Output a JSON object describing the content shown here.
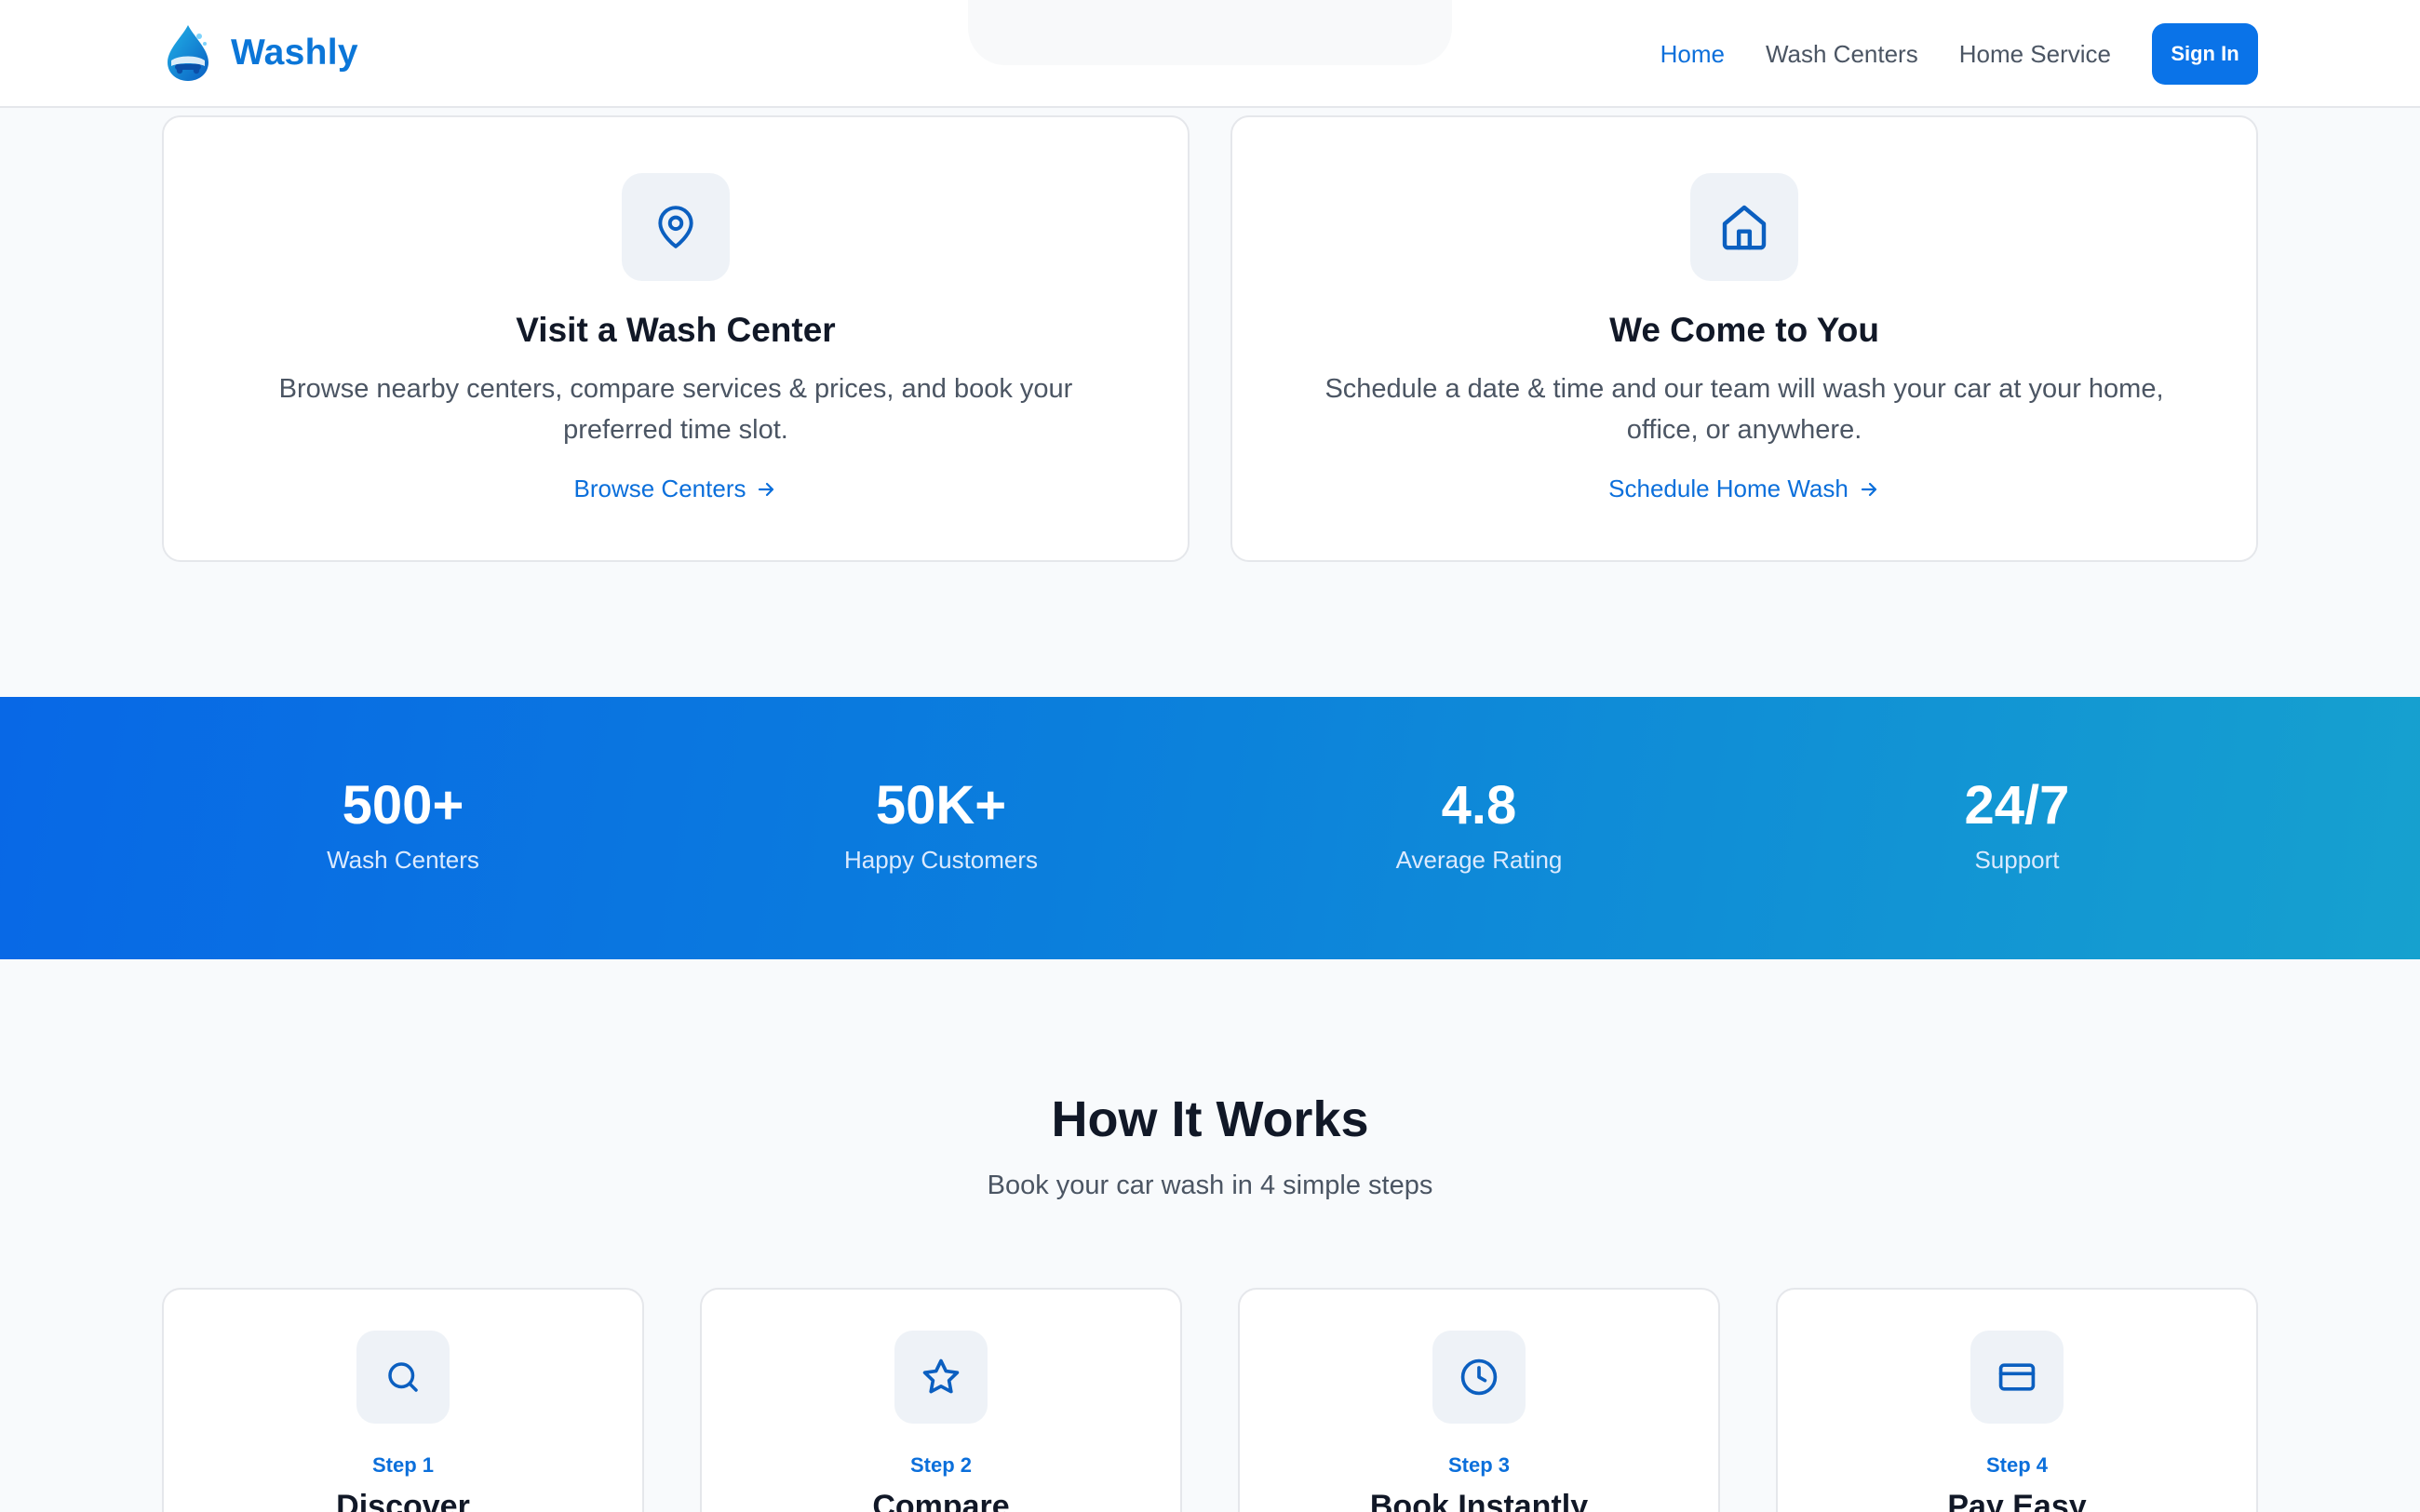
{
  "header": {
    "brand": "Washly",
    "nav": [
      {
        "label": "Home",
        "active": true
      },
      {
        "label": "Wash Centers",
        "active": false
      },
      {
        "label": "Home Service",
        "active": false
      }
    ],
    "signin_label": "Sign In"
  },
  "services": [
    {
      "icon": "map-pin-icon",
      "title": "Visit a Wash Center",
      "description": "Browse nearby centers, compare services & prices, and book your preferred time slot.",
      "link_label": "Browse Centers"
    },
    {
      "icon": "home-icon",
      "title": "We Come to You",
      "description": "Schedule a date & time and our team will wash your car at your home, office, or anywhere.",
      "link_label": "Schedule Home Wash"
    }
  ],
  "stats": [
    {
      "value": "500+",
      "label": "Wash Centers"
    },
    {
      "value": "50K+",
      "label": "Happy Customers"
    },
    {
      "value": "4.8",
      "label": "Average Rating"
    },
    {
      "value": "24/7",
      "label": "Support"
    }
  ],
  "how_it_works": {
    "title": "How It Works",
    "subtitle": "Book your car wash in 4 simple steps",
    "steps": [
      {
        "step": "Step 1",
        "title": "Discover",
        "icon": "search-icon"
      },
      {
        "step": "Step 2",
        "title": "Compare",
        "icon": "star-icon"
      },
      {
        "step": "Step 3",
        "title": "Book Instantly",
        "icon": "clock-icon"
      },
      {
        "step": "Step 4",
        "title": "Pay Easy",
        "icon": "credit-card-icon"
      }
    ]
  },
  "colors": {
    "brand": "#0b76d8",
    "accent": "#0a73e8",
    "link": "#0b6fdb",
    "stats_gradient_start": "#0868e6",
    "stats_gradient_end": "#16a1cf"
  }
}
